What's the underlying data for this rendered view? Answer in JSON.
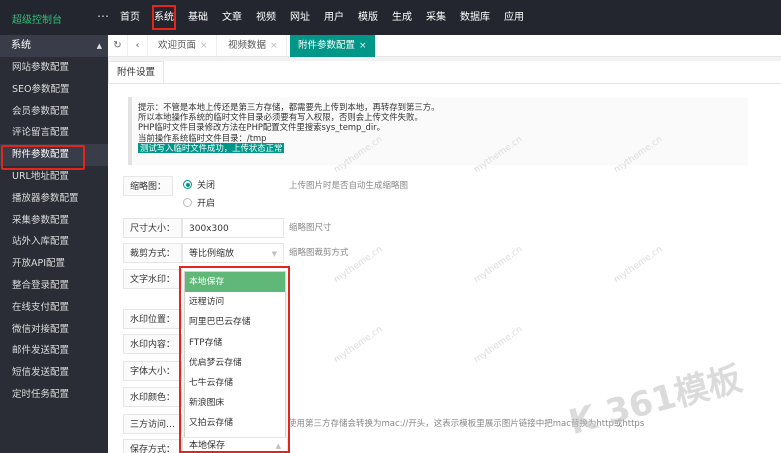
{
  "header": {
    "brand": "超级控制台",
    "menu_icon": "⋯",
    "nav": [
      "首页",
      "系统",
      "基础",
      "文章",
      "视频",
      "网址",
      "用户",
      "模版",
      "生成",
      "采集",
      "数据库",
      "应用"
    ],
    "active_nav": "系统"
  },
  "sidebar": {
    "title": "系统",
    "items": [
      "网站参数配置",
      "SEO参数配置",
      "会员参数配置",
      "评论留言配置",
      "附件参数配置",
      "URL地址配置",
      "播放器参数配置",
      "采集参数配置",
      "站外入库配置",
      "开放API配置",
      "整合登录配置",
      "在线支付配置",
      "微信对接配置",
      "邮件发送配置",
      "短信发送配置",
      "定时任务配置"
    ],
    "active": "附件参数配置"
  },
  "tabs": {
    "refresh_icon": "↻",
    "back_icon": "‹",
    "items": [
      "欢迎页面",
      "视频数据",
      "附件参数配置"
    ],
    "close": "×"
  },
  "form": {
    "subtab": "附件设置",
    "tip": {
      "line1": "提示：不管是本地上传还是第三方存储，都需要先上传到本地，再转存到第三方。",
      "line2": "所以本地操作系统的临时文件目录必须要有写入权限，否则会上传文件失败。",
      "line3": "PHP临时文件目录修改方法在PHP配置文件里搜索sys_temp_dir。",
      "line4": "当前操作系统临时文件目录：/tmp",
      "status": "测试写入临时文件成功，上传状态正常"
    },
    "thumb": {
      "label": "缩略图：",
      "opt_off": "关闭",
      "opt_on": "开启",
      "hint": "上传图片时是否自动生成缩略图"
    },
    "size": {
      "label": "尺寸大小：",
      "value": "300x300",
      "hint": "缩略图尺寸"
    },
    "crop": {
      "label": "裁剪方式：",
      "value": "等比例缩放",
      "hint": "缩略图裁剪方式"
    },
    "watermark": {
      "label": "文字水印："
    },
    "wm_pos": {
      "label": "水印位置："
    },
    "wm_content": {
      "label": "水印内容："
    },
    "font_size": {
      "label": "字体大小："
    },
    "wm_color": {
      "label": "水印颜色："
    },
    "third": {
      "label": "三方访问…",
      "hint": "使用第三方存储会转换为mac://开头，这表示模板里展示图片链接中把mac替换为http或https"
    },
    "save": {
      "label": "保存方式：",
      "value": "本地保存"
    },
    "dropdown": [
      "本地保存",
      "远程访问",
      "阿里巴巴云存储",
      "FTP存储",
      "优启梦云存储",
      "七牛云存储",
      "新浪图床",
      "又拍云存储"
    ]
  },
  "watermark_text": "mytheme.cn",
  "logo_text": "K 361模板",
  "colors": {
    "accent": "#009688",
    "highlight": "#e1261c",
    "selected": "#5fb878"
  }
}
